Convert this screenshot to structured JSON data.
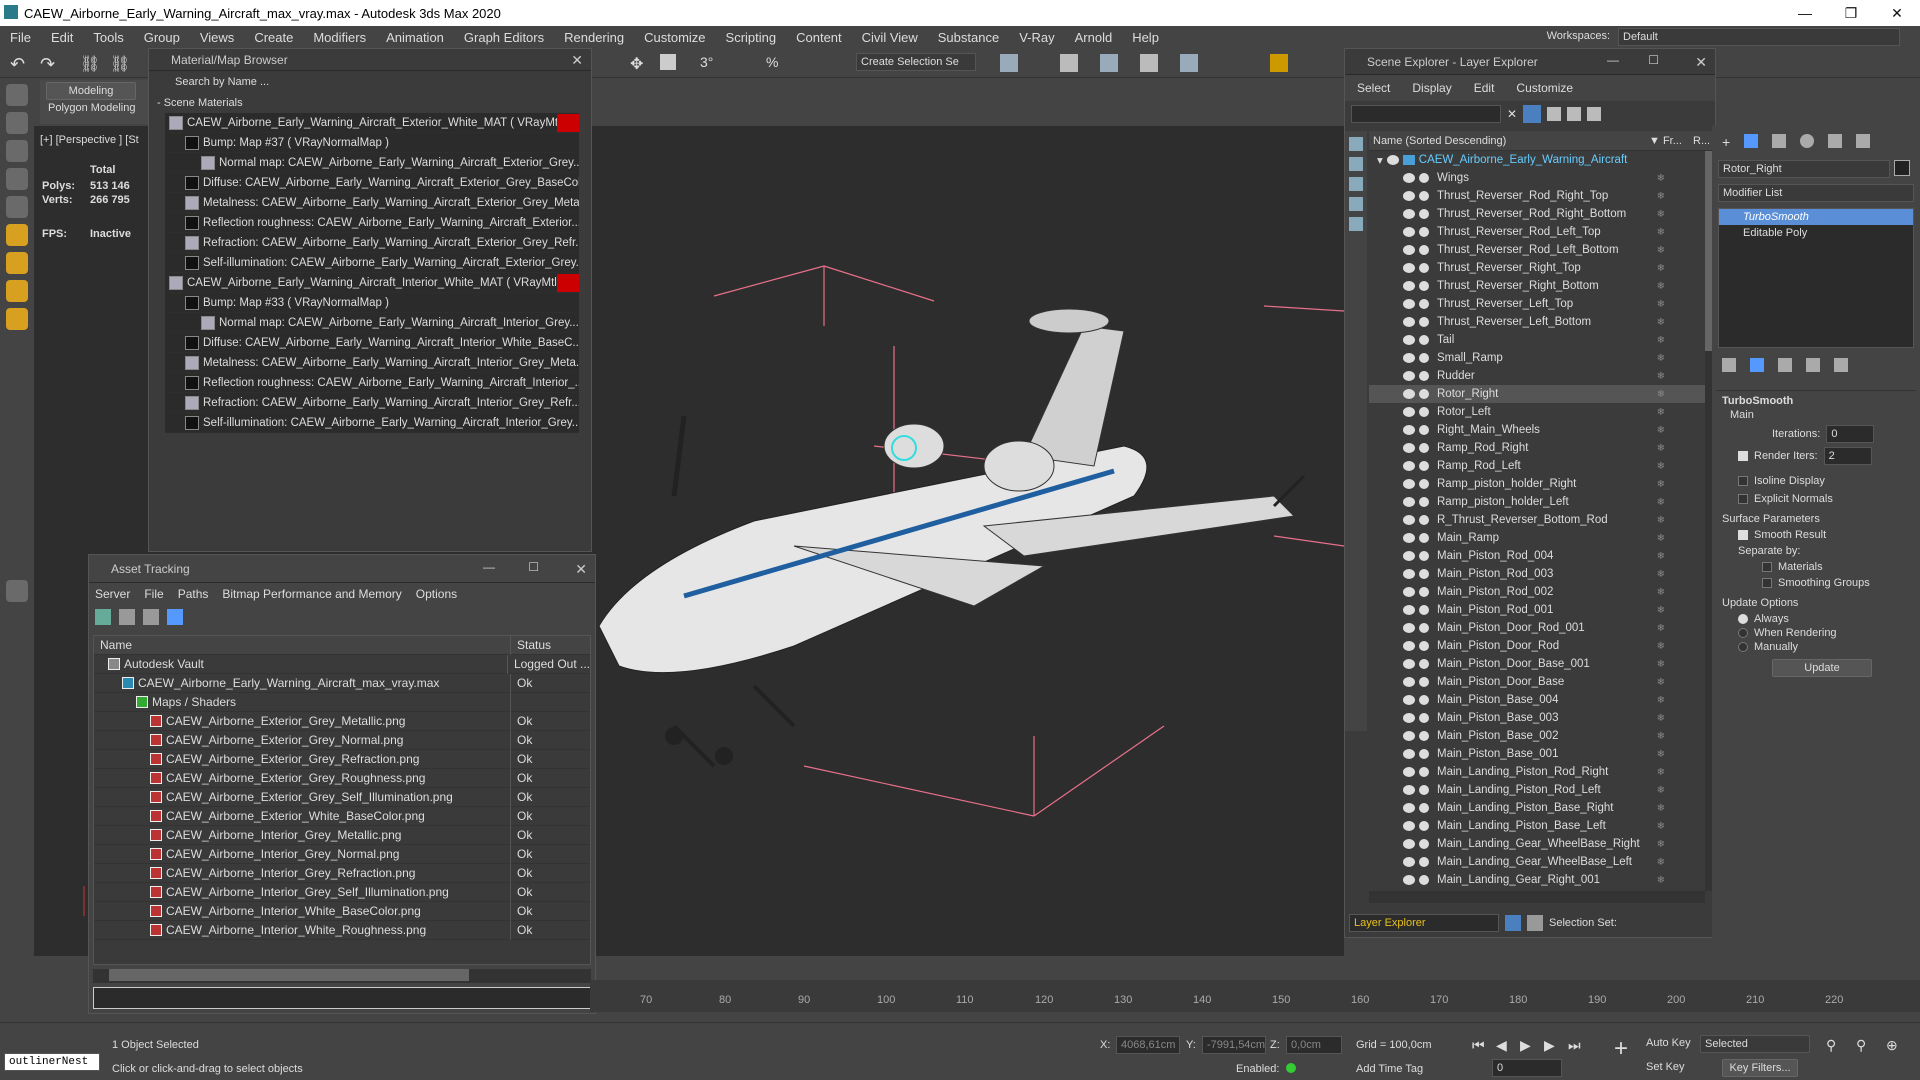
{
  "app": {
    "title": "CAEW_Airborne_Early_Warning_Aircraft_max_vray.max - Autodesk 3ds Max 2020"
  },
  "menu": [
    "File",
    "Edit",
    "Tools",
    "Group",
    "Views",
    "Create",
    "Modifiers",
    "Animation",
    "Graph Editors",
    "Rendering",
    "Customize",
    "Scripting",
    "Content",
    "Civil View",
    "Substance",
    "V-Ray",
    "Arnold",
    "Help"
  ],
  "workspace": {
    "label": "Workspaces:",
    "value": "Default"
  },
  "toolbar": {
    "selection_set": "Create Selection Se"
  },
  "ribbon": {
    "tab1": "Modeling",
    "tab2": "Polygon Modeling"
  },
  "viewport": {
    "label": "[+] [Perspective ] [St",
    "stats_total": "Total",
    "polys_label": "Polys:",
    "polys": "513 146",
    "verts_label": "Verts:",
    "verts": "266 795",
    "fps_label": "FPS:",
    "fps": "Inactive"
  },
  "material_browser": {
    "title": "Material/Map Browser",
    "search": "Search by Name ...",
    "section": "- Scene Materials",
    "rows": [
      {
        "text": "CAEW_Airborne_Early_Warning_Aircraft_Exterior_White_MAT ( VRayMtl )",
        "indent": 0,
        "red": true
      },
      {
        "text": "Bump: Map #37 ( VRayNormalMap )",
        "indent": 1,
        "red": false
      },
      {
        "text": "Normal map: CAEW_Airborne_Early_Warning_Aircraft_Exterior_Grey...",
        "indent": 2,
        "red": false
      },
      {
        "text": "Diffuse: CAEW_Airborne_Early_Warning_Aircraft_Exterior_Grey_BaseCol...",
        "indent": 1,
        "red": false
      },
      {
        "text": "Metalness: CAEW_Airborne_Early_Warning_Aircraft_Exterior_Grey_Meta...",
        "indent": 1,
        "red": false
      },
      {
        "text": "Reflection roughness: CAEW_Airborne_Early_Warning_Aircraft_Exterior...",
        "indent": 1,
        "red": false
      },
      {
        "text": "Refraction: CAEW_Airborne_Early_Warning_Aircraft_Exterior_Grey_Refr...",
        "indent": 1,
        "red": false
      },
      {
        "text": "Self-illumination: CAEW_Airborne_Early_Warning_Aircraft_Exterior_Grey...",
        "indent": 1,
        "red": false
      },
      {
        "text": "CAEW_Airborne_Early_Warning_Aircraft_Interior_White_MAT ( VRayMtl )",
        "indent": 0,
        "red": true
      },
      {
        "text": "Bump: Map #33 ( VRayNormalMap )",
        "indent": 1,
        "red": false
      },
      {
        "text": "Normal map: CAEW_Airborne_Early_Warning_Aircraft_Interior_Grey...",
        "indent": 2,
        "red": false
      },
      {
        "text": "Diffuse: CAEW_Airborne_Early_Warning_Aircraft_Interior_White_BaseC...",
        "indent": 1,
        "red": false
      },
      {
        "text": "Metalness: CAEW_Airborne_Early_Warning_Aircraft_Interior_Grey_Meta...",
        "indent": 1,
        "red": false
      },
      {
        "text": "Reflection roughness: CAEW_Airborne_Early_Warning_Aircraft_Interior_...",
        "indent": 1,
        "red": false
      },
      {
        "text": "Refraction: CAEW_Airborne_Early_Warning_Aircraft_Interior_Grey_Refr...",
        "indent": 1,
        "red": false
      },
      {
        "text": "Self-illumination: CAEW_Airborne_Early_Warning_Aircraft_Interior_Grey...",
        "indent": 1,
        "red": false
      }
    ]
  },
  "asset_tracking": {
    "title": "Asset Tracking",
    "menu": [
      "Server",
      "File",
      "Paths",
      "Bitmap Performance and Memory",
      "Options"
    ],
    "col_name": "Name",
    "col_status": "Status",
    "rows": [
      {
        "name": "Autodesk Vault",
        "status": "Logged Out ...",
        "indent": 1
      },
      {
        "name": "CAEW_Airborne_Early_Warning_Aircraft_max_vray.max",
        "status": "Ok",
        "indent": 2
      },
      {
        "name": "Maps / Shaders",
        "status": "",
        "indent": 3
      },
      {
        "name": "CAEW_Airborne_Exterior_Grey_Metallic.png",
        "status": "Ok",
        "indent": 4
      },
      {
        "name": "CAEW_Airborne_Exterior_Grey_Normal.png",
        "status": "Ok",
        "indent": 4
      },
      {
        "name": "CAEW_Airborne_Exterior_Grey_Refraction.png",
        "status": "Ok",
        "indent": 4
      },
      {
        "name": "CAEW_Airborne_Exterior_Grey_Roughness.png",
        "status": "Ok",
        "indent": 4
      },
      {
        "name": "CAEW_Airborne_Exterior_Grey_Self_Illumination.png",
        "status": "Ok",
        "indent": 4
      },
      {
        "name": "CAEW_Airborne_Exterior_White_BaseColor.png",
        "status": "Ok",
        "indent": 4
      },
      {
        "name": "CAEW_Airborne_Interior_Grey_Metallic.png",
        "status": "Ok",
        "indent": 4
      },
      {
        "name": "CAEW_Airborne_Interior_Grey_Normal.png",
        "status": "Ok",
        "indent": 4
      },
      {
        "name": "CAEW_Airborne_Interior_Grey_Refraction.png",
        "status": "Ok",
        "indent": 4
      },
      {
        "name": "CAEW_Airborne_Interior_Grey_Self_Illumination.png",
        "status": "Ok",
        "indent": 4
      },
      {
        "name": "CAEW_Airborne_Interior_White_BaseColor.png",
        "status": "Ok",
        "indent": 4
      },
      {
        "name": "CAEW_Airborne_Interior_White_Roughness.png",
        "status": "Ok",
        "indent": 4
      }
    ]
  },
  "scene_explorer": {
    "title": "Scene Explorer - Layer Explorer",
    "menu": [
      "Select",
      "Display",
      "Edit",
      "Customize"
    ],
    "col_name": "Name (Sorted Descending)",
    "col_fr": "▼ Fr...",
    "col_r": "R...",
    "root": "CAEW_Airborne_Early_Warning_Aircraft",
    "selected": "Rotor_Right",
    "items": [
      "Wings",
      "Thrust_Reverser_Rod_Right_Top",
      "Thrust_Reverser_Rod_Right_Bottom",
      "Thrust_Reverser_Rod_Left_Top",
      "Thrust_Reverser_Rod_Left_Bottom",
      "Thrust_Reverser_Right_Top",
      "Thrust_Reverser_Right_Bottom",
      "Thrust_Reverser_Left_Top",
      "Thrust_Reverser_Left_Bottom",
      "Tail",
      "Small_Ramp",
      "Rudder",
      "Rotor_Right",
      "Rotor_Left",
      "Right_Main_Wheels",
      "Ramp_Rod_Right",
      "Ramp_Rod_Left",
      "Ramp_piston_holder_Right",
      "Ramp_piston_holder_Left",
      "R_Thrust_Reverser_Bottom_Rod",
      "Main_Ramp",
      "Main_Piston_Rod_004",
      "Main_Piston_Rod_003",
      "Main_Piston_Rod_002",
      "Main_Piston_Rod_001",
      "Main_Piston_Door_Rod_001",
      "Main_Piston_Door_Rod",
      "Main_Piston_Door_Base_001",
      "Main_Piston_Door_Base",
      "Main_Piston_Base_004",
      "Main_Piston_Base_003",
      "Main_Piston_Base_002",
      "Main_Piston_Base_001",
      "Main_Landing_Piston_Rod_Right",
      "Main_Landing_Piston_Rod_Left",
      "Main_Landing_Piston_Base_Right",
      "Main_Landing_Piston_Base_Left",
      "Main_Landing_Gear_WheelBase_Right",
      "Main_Landing_Gear_WheelBase_Left",
      "Main_Landing_Gear_Right_001"
    ],
    "footer_layer": "Layer Explorer",
    "footer_sel": "Selection Set:"
  },
  "command_panel": {
    "object_name": "Rotor_Right",
    "modifier_list": "Modifier List",
    "stack": [
      "TurboSmooth",
      "Editable Poly"
    ],
    "rollout": "TurboSmooth",
    "main": "Main",
    "iterations_label": "Iterations:",
    "iterations": "0",
    "render_iters_label": "Render Iters:",
    "render_iters": "2",
    "isoline": "Isoline Display",
    "explicit": "Explicit Normals",
    "surface": "Surface Parameters",
    "smooth": "Smooth Result",
    "separate": "Separate by:",
    "materials": "Materials",
    "smoothing": "Smoothing Groups",
    "update_opts": "Update Options",
    "always": "Always",
    "when_rendering": "When Rendering",
    "manually": "Manually",
    "update_btn": "Update"
  },
  "timeline": {
    "ticks": [
      "70",
      "80",
      "90",
      "100",
      "110",
      "120",
      "130",
      "140",
      "150",
      "160",
      "170",
      "180",
      "190",
      "200",
      "210",
      "220"
    ]
  },
  "status": {
    "maxscript": "outlinerNest",
    "selected": "1 Object Selected",
    "prompt": "Click or click-and-drag to select objects",
    "x_label": "X:",
    "x": "4068,61cm",
    "y_label": "Y:",
    "y": "-7991,54cm",
    "z_label": "Z:",
    "z": "0,0cm",
    "grid": "Grid = 100,0cm",
    "enabled": "Enabled:",
    "add_time_tag": "Add Time Tag",
    "auto_key": "Auto Key",
    "selected_dd": "Selected",
    "set_key": "Set Key",
    "key_filters": "Key Filters...",
    "frame": "0"
  },
  "colors": {
    "accent": "#5a8fd8",
    "red": "#c00000",
    "yellow": "#e8c020"
  }
}
